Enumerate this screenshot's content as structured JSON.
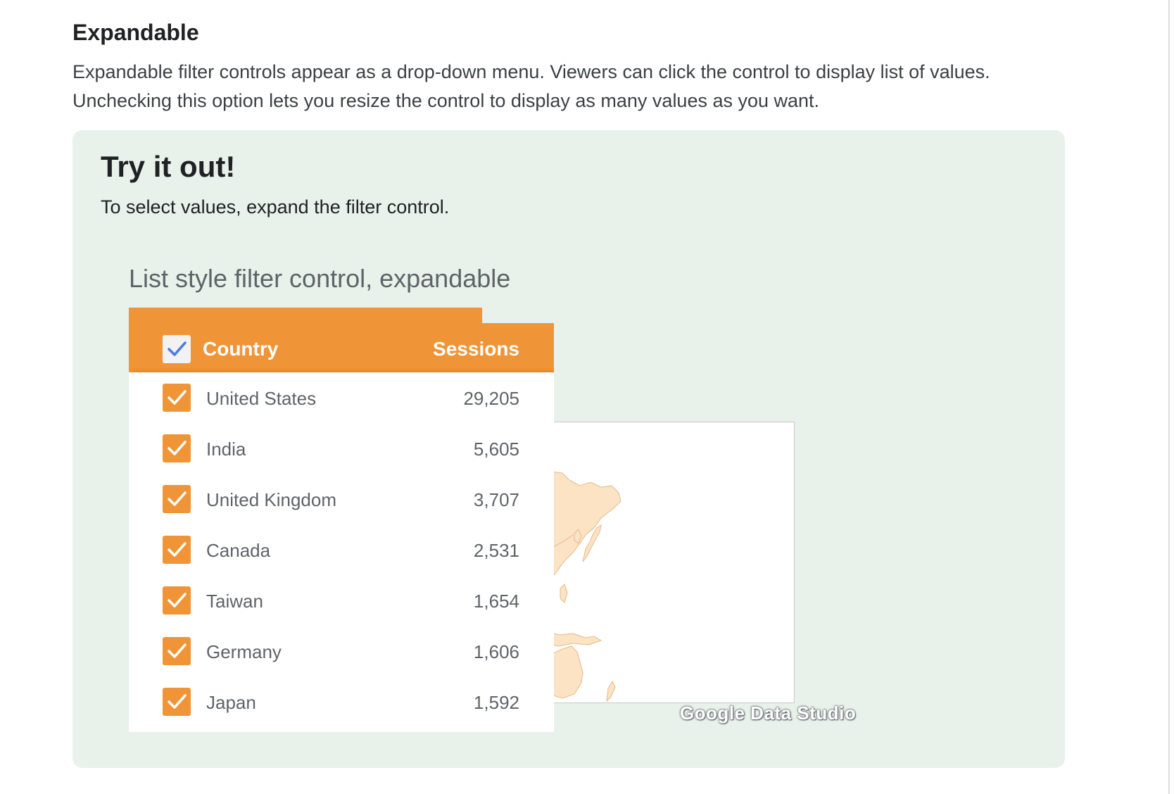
{
  "section": {
    "title": "Expandable",
    "description_line1": "Expandable filter controls appear as a drop-down menu. Viewers can click the control to display list of values.",
    "description_line2": "Unchecking this option lets you resize the control to display as many values as you want."
  },
  "try_it": {
    "title": "Try it out!",
    "subtitle": "To select values, expand the filter control."
  },
  "demo": {
    "heading": "List style filter control, expandable",
    "watermark": "Google Data Studio",
    "colors": {
      "accent": "#f09537",
      "panel_background": "#e8f1ea",
      "map_land": "#fbe3c4",
      "header_check": "#4a7be0"
    }
  },
  "filter": {
    "header": {
      "country_label": "Country",
      "sessions_label": "Sessions",
      "all_checked": true,
      "check_icon": "check-icon"
    },
    "rows": [
      {
        "country": "United States",
        "sessions": "29,205",
        "checked": true
      },
      {
        "country": "India",
        "sessions": "5,605",
        "checked": true
      },
      {
        "country": "United Kingdom",
        "sessions": "3,707",
        "checked": true
      },
      {
        "country": "Canada",
        "sessions": "2,531",
        "checked": true
      },
      {
        "country": "Taiwan",
        "sessions": "1,654",
        "checked": true
      },
      {
        "country": "Germany",
        "sessions": "1,606",
        "checked": true
      },
      {
        "country": "Japan",
        "sessions": "1,592",
        "checked": true
      }
    ]
  }
}
